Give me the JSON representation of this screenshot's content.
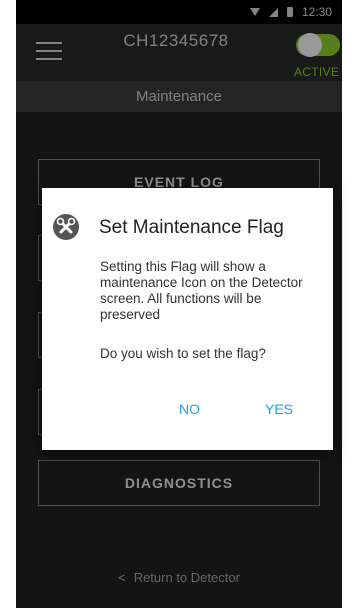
{
  "status_bar": {
    "time": "12:30",
    "icons": [
      "wifi-icon",
      "signal-icon",
      "battery-icon"
    ]
  },
  "app_bar": {
    "device_id": "CH12345678",
    "toggle_state": "on",
    "toggle_label": "ACTIVE",
    "accent_color": "#8fd42b"
  },
  "subheader": {
    "title": "Maintenance"
  },
  "menu": {
    "items": [
      {
        "label": "EVENT LOG"
      },
      {
        "label": ""
      },
      {
        "label": ""
      },
      {
        "label": ""
      },
      {
        "label": "DIAGNOSTICS"
      }
    ]
  },
  "footer": {
    "return_label": "Return to Detector"
  },
  "dialog": {
    "icon": "wrench-icon",
    "title": "Set Maintenance Flag",
    "message": "Setting this Flag will show a maintenance Icon on the Detector screen. All functions will be preserved",
    "question": "Do you wish to set the flag?",
    "no_label": "NO",
    "yes_label": "YES",
    "button_color": "#1fa0d8"
  }
}
